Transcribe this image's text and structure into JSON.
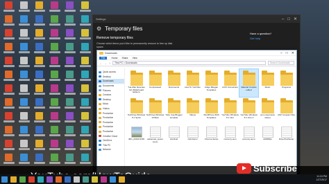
{
  "settings": {
    "window_title": "Settings",
    "title": "Temporary files",
    "subtitle": "Remove temporary files",
    "description": "Choose which items you'd like to permanently remove to free up disk space.",
    "question": "Have a question?",
    "help_link": "Get help"
  },
  "explorer": {
    "window_title": "Downloads",
    "ribbon": [
      "File",
      "Home",
      "Share",
      "View"
    ],
    "address": "This PC > Downloads",
    "search_placeholder": "Search Downloads",
    "nav_items": [
      {
        "label": "Quick access",
        "color": "#3b8fd6"
      },
      {
        "label": "Desktop",
        "color": "#2f7fd0"
      },
      {
        "label": "Downloads",
        "color": "#1e6fbf"
      },
      {
        "label": "Documents",
        "color": "#7aa6cf"
      },
      {
        "label": "Pictures",
        "color": "#6fa3d6"
      },
      {
        "label": "Creators",
        "color": "#e3ad2b"
      },
      {
        "label": "Desktop",
        "color": "#2f7fd0"
      },
      {
        "label": "Music",
        "color": "#e3ad2b"
      },
      {
        "label": "Videos",
        "color": "#e3ad2b"
      },
      {
        "label": "Production",
        "color": "#e3ad2b"
      },
      {
        "label": "Production",
        "color": "#e3ad2b"
      },
      {
        "label": "Production",
        "color": "#e3ad2b"
      },
      {
        "label": "Production",
        "color": "#e3ad2b"
      },
      {
        "label": "Production",
        "color": "#e3ad2b"
      },
      {
        "label": "Creative Cloud",
        "color": "#d8412f"
      },
      {
        "label": "OneDrive",
        "color": "#2f7fd0"
      },
      {
        "label": "This PC",
        "color": "#3b8fd6"
      },
      {
        "label": "Network",
        "color": "#3b8fd6"
      }
    ],
    "folders_row1": [
      "*He-Man Rescues Intl (Sliderboard Edition)",
      "Compressed",
      "Documents",
      "How To YouTube",
      "Indigo Blogger Templates",
      "LICO Conversion",
      "Material Youtube edited",
      "Music",
      "Programs"
    ],
    "folders_row2": [
      "TechFreq Windows 8.1 Sprint",
      "TechFreq Windows 10 Beta",
      "Tube map Blogger template",
      "Videos",
      "WordPress 2016 Templates",
      "YouTube Windows 8.1 Intro",
      "YouTube Windows 8.1 Intro 2",
      "sum responsive videos",
      "2017 program files"
    ],
    "extra_folder": "Publisher",
    "files_row": [
      "IMG_20160 9165",
      "advanced_power menu",
      "cbd-fluid",
      "cbd-fluid-2",
      "Chrome-Setup",
      "currency-as.it",
      "currency-as.in",
      "d4f48b0e",
      "DriverToolSetup"
    ],
    "status": "34 items"
  },
  "overlay": {
    "channel": "YouTube.com/HowToGuide",
    "subscribe": "Subscribe"
  },
  "tray": {
    "time": "11:24 PM",
    "date": "1/27/2017"
  }
}
